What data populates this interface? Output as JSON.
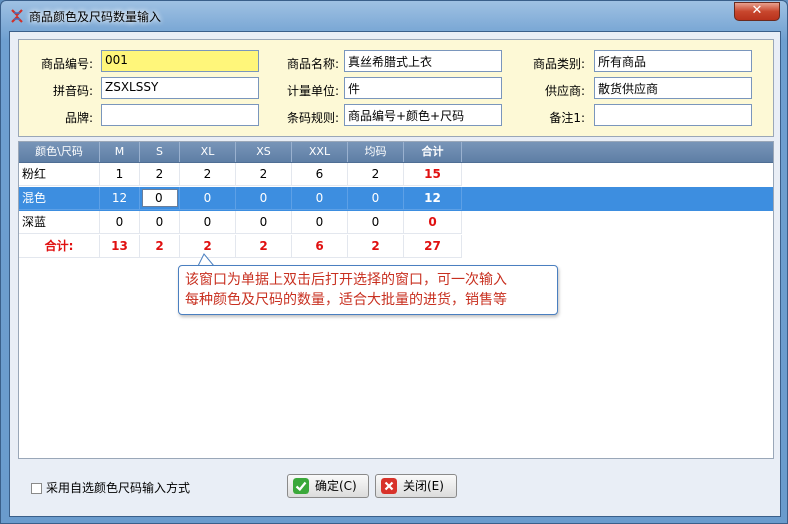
{
  "window": {
    "title": "商品颜色及尺码数量输入",
    "close_glyph": "✕"
  },
  "header": {
    "fields": {
      "product_code": {
        "label": "商品编号:",
        "value": "001"
      },
      "product_name": {
        "label": "商品名称:",
        "value": "真丝希腊式上衣"
      },
      "category": {
        "label": "商品类别:",
        "value": "所有商品"
      },
      "pinyin": {
        "label": "拼音码:",
        "value": "ZSXLSSY"
      },
      "unit": {
        "label": "计量单位:",
        "value": "件"
      },
      "supplier": {
        "label": "供应商:",
        "value": "散货供应商"
      },
      "brand": {
        "label": "品牌:",
        "value": ""
      },
      "barcode_rule": {
        "label": "条码规则:",
        "value": "商品编号+颜色+尺码"
      },
      "note": {
        "label": "备注1:",
        "value": ""
      }
    }
  },
  "grid": {
    "columns": [
      "颜色\\尺码",
      "M",
      "S",
      "XL",
      "XS",
      "XXL",
      "均码",
      "合计"
    ],
    "rows": [
      {
        "name": "粉红",
        "values": [
          "1",
          "2",
          "2",
          "2",
          "6",
          "2"
        ],
        "total": "15"
      },
      {
        "name": "混色",
        "values": [
          "12",
          "0",
          "0",
          "0",
          "0",
          "0"
        ],
        "total": "12"
      },
      {
        "name": "深蓝",
        "values": [
          "0",
          "0",
          "0",
          "0",
          "0",
          "0"
        ],
        "total": "0"
      }
    ],
    "totals": {
      "label": "合计:",
      "values": [
        "13",
        "2",
        "2",
        "2",
        "6",
        "2"
      ],
      "total": "27"
    }
  },
  "tooltip": {
    "line1": "该窗口为单据上双击后打开选择的窗口，可一次输入",
    "line2": "每种颜色及尺码的数量，适合大批量的进货，销售等"
  },
  "footer": {
    "checkbox_label": "采用自选颜色尺码输入方式",
    "confirm_label": "确定(C)",
    "close_label": "关闭(E)"
  },
  "colors": {
    "accent_red": "#e01010",
    "selection": "#3d8ee0",
    "highlight_input": "#fff67a"
  }
}
